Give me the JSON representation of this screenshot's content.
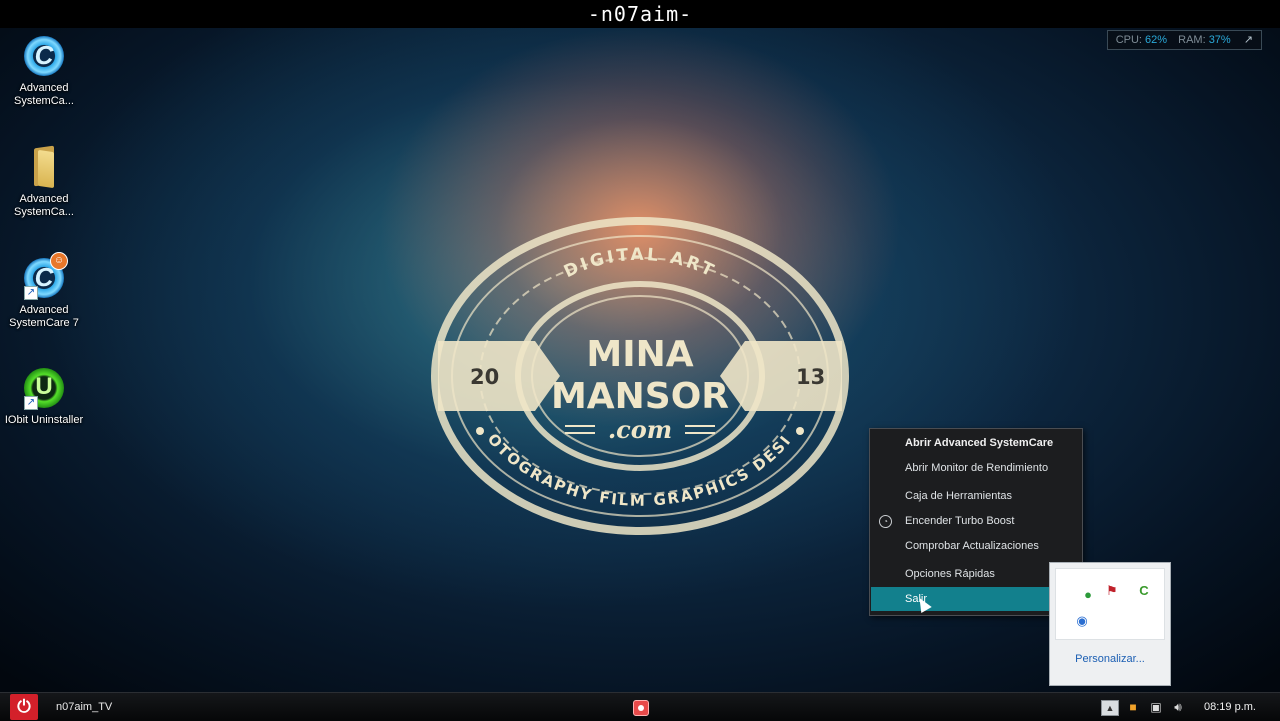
{
  "window_title": "-n07aim-",
  "perf_widget": {
    "cpu_label": "CPU:",
    "cpu_value": "62%",
    "ram_label": "RAM:",
    "ram_value": "37%",
    "expand_glyph": "↗"
  },
  "desktop_icons": [
    {
      "label_line1": "Advanced",
      "label_line2": "SystemCa...",
      "icon": "advanced-systemcare-icon"
    },
    {
      "label_line1": "Advanced",
      "label_line2": "SystemCa...",
      "icon": "folder-icon"
    },
    {
      "label_line1": "Advanced",
      "label_line2": "SystemCare 7",
      "icon": "advanced-systemcare-7-icon",
      "badge": "☺"
    },
    {
      "label_line1": "IObit Uninstaller",
      "label_line2": "",
      "icon": "iobit-uninstaller-icon"
    }
  ],
  "wallpaper_logo": {
    "top_text": "DIGITAL ART",
    "name_line1": "MINA",
    "name_line2": "MANSOR",
    "domain": ".com",
    "year_left": "20",
    "year_right": "13",
    "bottom_text": "PHOTOGRAPHY FILM GRAPHICS DESIGN"
  },
  "context_menu": {
    "items": [
      {
        "label": "Abrir Advanced SystemCare",
        "bold": true
      },
      {
        "label": "Abrir Monitor de Rendimiento"
      },
      {
        "label": "Caja de Herramientas"
      },
      {
        "label": "Encender Turbo Boost",
        "icon": "turbo-boost-icon"
      },
      {
        "label": "Comprobar Actualizaciones"
      },
      {
        "label": "Opciones Rápidas"
      },
      {
        "label": "Salir",
        "active": true
      }
    ]
  },
  "tray_popup": {
    "customize_label": "Personalizar..."
  },
  "taskbar": {
    "user_label": "n07aim_TV",
    "clock": "08:19 p.m.",
    "power_glyph": "⏻",
    "show_hidden_glyph": "▲"
  },
  "colors": {
    "menu_highlight": "#12808d",
    "power_button": "#d3202a",
    "perf_value": "#2aa9d9"
  }
}
